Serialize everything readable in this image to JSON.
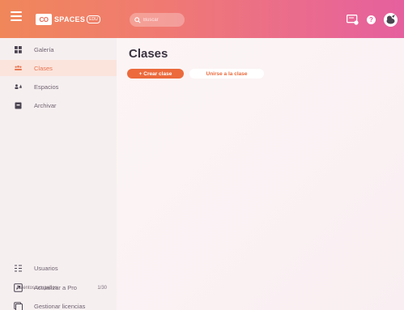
{
  "header": {
    "logo_box": "CO",
    "logo_text": "SPACES",
    "logo_edu": "EDU",
    "search_placeholder": "Buscar"
  },
  "sidebar": {
    "items": [
      {
        "label": "Galería",
        "icon": "grid-icon"
      },
      {
        "label": "Clases",
        "icon": "class-group-icon",
        "active": true
      },
      {
        "label": "Espacios",
        "icon": "spaces-people-icon"
      },
      {
        "label": "Archivar",
        "icon": "archive-icon"
      }
    ],
    "seats_label": "Asientos ocupados:",
    "seats_value": "1/30",
    "bottom_items": [
      {
        "label": "Usuarios",
        "icon": "users-list-icon"
      },
      {
        "label": "Actualizar a Pro",
        "icon": "upgrade-icon"
      },
      {
        "label": "Gestionar licencias",
        "icon": "licenses-icon"
      }
    ]
  },
  "main": {
    "title": "Clases",
    "create_button": "+ Crear clase",
    "join_button": "Unirse a la clase"
  },
  "colors": {
    "accent": "#ec6a3c",
    "header_gradient_start": "#f0875a",
    "header_gradient_end": "#e5609e",
    "active_bg": "#fbe4dc"
  }
}
